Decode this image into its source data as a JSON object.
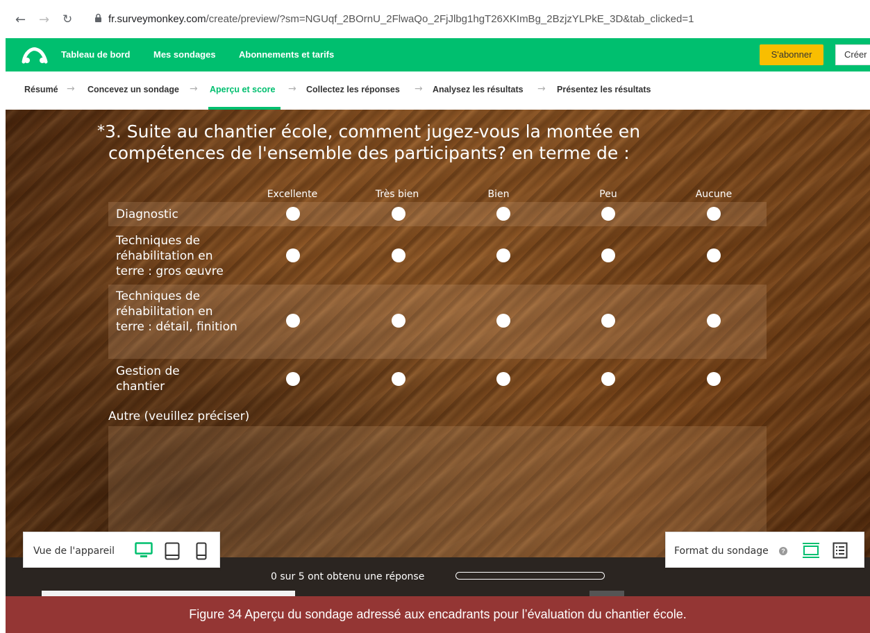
{
  "browser": {
    "url_host": "fr.surveymonkey.com",
    "url_path": "/create/preview/?sm=NGUqf_2BOrnU_2FlwaQo_2FjJlbg1hgT26XKImBg_2BzjzYLPkE_3D&tab_clicked=1"
  },
  "topnav": {
    "links": [
      "Tableau de bord",
      "Mes sondages",
      "Abonnements et tarifs"
    ],
    "subscribe_label": "S'abonner",
    "create_label": "Créer",
    "brand_color": "#00bf6f"
  },
  "steps": [
    "Résumé",
    "Concevez un sondage",
    "Aperçu et score",
    "Collectez les réponses",
    "Analysez les résultats",
    "Présentez les résultats"
  ],
  "active_step": "Aperçu et score",
  "question": {
    "required_marker": "*",
    "line1": "3. Suite au chantier école, comment jugez-vous la montée en",
    "line2": "compétences de l'ensemble des participants? en terme de :"
  },
  "columns": [
    "Excellente",
    "Très bien",
    "Bien",
    "Peu",
    "Aucune"
  ],
  "rows": [
    {
      "label": "Diagnostic"
    },
    {
      "label": "Techniques de réhabilitation en terre : gros œuvre"
    },
    {
      "label": "Techniques de réhabilitation en terre : détail, finition"
    },
    {
      "label": "Gestion de chantier"
    }
  ],
  "other_label": "Autre (veuillez préciser)",
  "progress": {
    "text": "0 sur 5 ont obtenu une réponse",
    "fraction": 0
  },
  "device_view_label": "Vue de l'appareil",
  "format_label": "Format du sondage",
  "caption": "Figure 34 Aperçu du sondage adressé aux encadrants pour l’évaluation du chantier école."
}
